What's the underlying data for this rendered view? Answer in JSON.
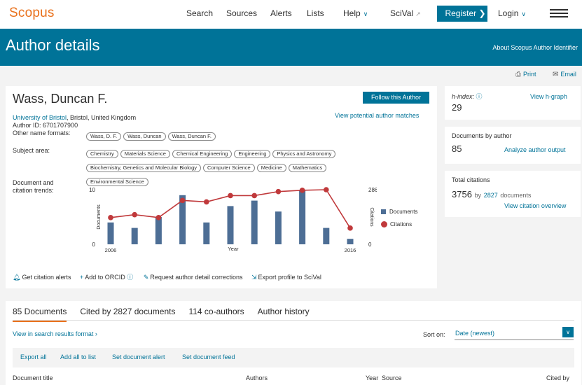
{
  "nav": {
    "logo": "Scopus",
    "items": [
      "Search",
      "Sources",
      "Alerts",
      "Lists"
    ],
    "help": "Help",
    "scival": "SciVal",
    "register": "Register",
    "login": "Login"
  },
  "banner": {
    "title": "Author details",
    "link": "About Scopus Author Identifier"
  },
  "tools": {
    "print": "Print",
    "email": "Email"
  },
  "author": {
    "name": "Wass, Duncan F.",
    "follow": "Follow this Author",
    "affiliation_link": "University of Bristol",
    "affiliation_rest": ", Bristol, United Kingdom",
    "potential": "View potential author matches",
    "author_id": "Author ID: 6701707900",
    "other_label": "Other name formats:",
    "other_names": [
      "Wass, D. F.",
      "Wass, Duncan",
      "Wass, Duncan F."
    ],
    "subject_label": "Subject area:",
    "subjects": [
      "Chemistry",
      "Materials Science",
      "Chemical Engineering",
      "Engineering",
      "Physics and Astronomy",
      "Biochemistry, Genetics and Molecular Biology",
      "Computer Science",
      "Medicine",
      "Mathematics",
      "Environmental Science"
    ],
    "trend_label_1": "Document and",
    "trend_label_2": "citation trends:",
    "actions": {
      "alerts": "Get citation alerts",
      "orcid": "Add to ORCID",
      "corrections": "Request author detail corrections",
      "export": "Export profile to SciVal"
    }
  },
  "chart_data": {
    "type": "bar",
    "x": [
      2006,
      2007,
      2008,
      2009,
      2010,
      2011,
      2012,
      2013,
      2014,
      2015,
      2016
    ],
    "series": [
      {
        "name": "Documents",
        "type": "bar",
        "axis": "left",
        "color": "#4d6e95",
        "values": [
          4,
          3,
          5,
          9,
          4,
          7,
          8,
          6,
          10,
          3,
          1
        ]
      },
      {
        "name": "Citations",
        "type": "line",
        "axis": "right",
        "color": "#c0393b",
        "values": [
          140,
          155,
          140,
          230,
          222,
          255,
          255,
          276,
          283,
          286,
          85
        ]
      }
    ],
    "xlabel": "Year",
    "ylabel_left": "Documents",
    "ylabel_right": "Citations",
    "ylim_left": [
      0,
      10
    ],
    "ylim_right": [
      0,
      286
    ],
    "left_ticks": [
      "10",
      "0"
    ],
    "right_ticks": [
      "286",
      "0"
    ],
    "x_ticks": [
      "2006",
      "2016"
    ],
    "legend_position": "right"
  },
  "metrics": {
    "h_label": "h-index:",
    "h_value": "29",
    "h_link": "View h-graph",
    "docs_label": "Documents by author",
    "docs_value": "85",
    "docs_link": "Analyze author output",
    "cit_label": "Total citations",
    "cit_value": "3756",
    "cit_by": "by",
    "cit_docs": "2827",
    "cit_docs_word": "documents",
    "cit_link": "View citation overview"
  },
  "docs": {
    "tabs": [
      "85 Documents",
      "Cited by 2827 documents",
      "114 co-authors",
      "Author history"
    ],
    "view_link": "View in search results format",
    "sort_label": "Sort on:",
    "sort_value": "Date (newest)",
    "toolbar": [
      "Export all",
      "Add all to list",
      "Set document alert",
      "Set document feed"
    ],
    "columns": [
      "Document title",
      "Authors",
      "Year",
      "Source",
      "Cited by"
    ]
  },
  "colors": {
    "accent": "#007398",
    "brand": "#e9711c",
    "bar": "#4d6e95",
    "line": "#c0393b"
  }
}
